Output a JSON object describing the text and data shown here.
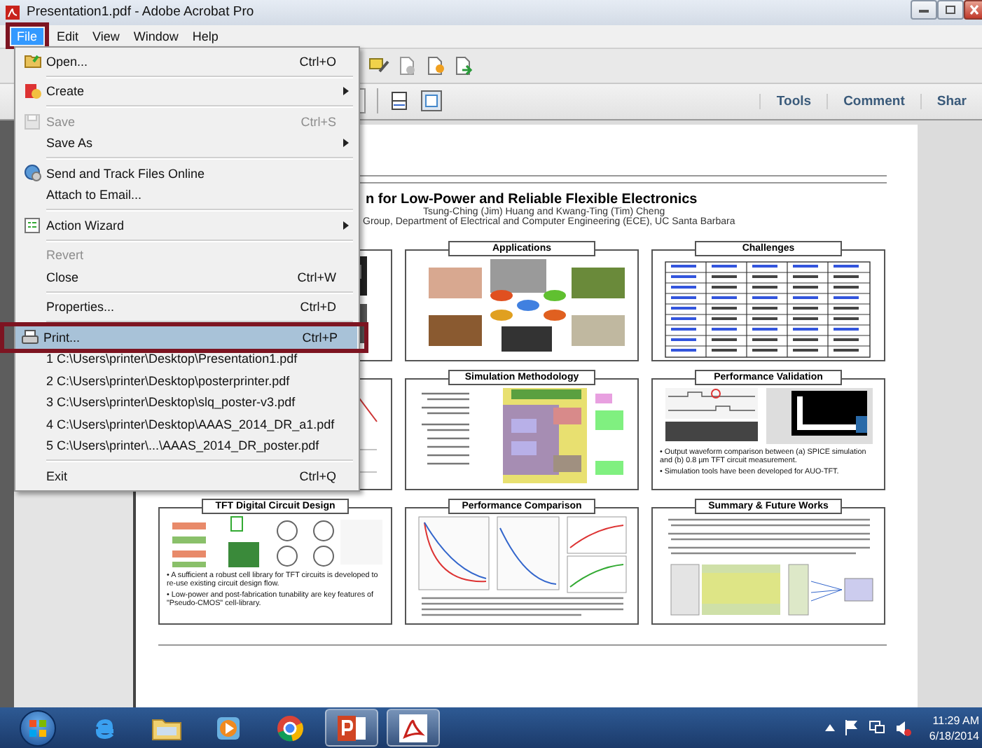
{
  "window": {
    "title": "Presentation1.pdf - Adobe Acrobat Pro"
  },
  "menu_bar": [
    {
      "label": "File",
      "selected": true
    },
    {
      "label": "Edit",
      "selected": false
    },
    {
      "label": "View",
      "selected": false
    },
    {
      "label": "Window",
      "selected": false
    },
    {
      "label": "Help",
      "selected": false
    }
  ],
  "file_menu": [
    {
      "kind": "item",
      "label": "Open...",
      "shortcut": "Ctrl+O",
      "submenu": false,
      "disabled": false,
      "selected": false
    },
    {
      "kind": "separator"
    },
    {
      "kind": "item",
      "label": "Create",
      "submenu": true,
      "disabled": false,
      "selected": false
    },
    {
      "kind": "separator"
    },
    {
      "kind": "item",
      "label": "Save",
      "shortcut": "Ctrl+S",
      "submenu": false,
      "disabled": true,
      "selected": false
    },
    {
      "kind": "item",
      "label": "Save As",
      "submenu": true,
      "disabled": false,
      "selected": false
    },
    {
      "kind": "separator"
    },
    {
      "kind": "item",
      "label": "Send and Track Files Online",
      "submenu": false,
      "disabled": false,
      "selected": false
    },
    {
      "kind": "item",
      "label": "Attach to Email...",
      "submenu": false,
      "disabled": false,
      "selected": false
    },
    {
      "kind": "separator"
    },
    {
      "kind": "item",
      "label": "Action Wizard",
      "submenu": true,
      "disabled": false,
      "selected": false
    },
    {
      "kind": "separator"
    },
    {
      "kind": "item",
      "label": "Revert",
      "submenu": false,
      "disabled": true,
      "selected": false
    },
    {
      "kind": "item",
      "label": "Close",
      "shortcut": "Ctrl+W",
      "submenu": false,
      "disabled": false,
      "selected": false
    },
    {
      "kind": "separator"
    },
    {
      "kind": "item",
      "label": "Properties...",
      "shortcut": "Ctrl+D",
      "submenu": false,
      "disabled": false,
      "selected": false
    },
    {
      "kind": "separator"
    },
    {
      "kind": "item",
      "label": "Print...",
      "shortcut": "Ctrl+P",
      "submenu": false,
      "disabled": false,
      "selected": true
    },
    {
      "kind": "item",
      "label": "1 C:\\Users\\printer\\Desktop\\Presentation1.pdf",
      "submenu": false,
      "disabled": false,
      "selected": false
    },
    {
      "kind": "item",
      "label": "2 C:\\Users\\printer\\Desktop\\posterprinter.pdf",
      "submenu": false,
      "disabled": false,
      "selected": false
    },
    {
      "kind": "item",
      "label": "3 C:\\Users\\printer\\Desktop\\slq_poster-v3.pdf",
      "submenu": false,
      "disabled": false,
      "selected": false
    },
    {
      "kind": "item",
      "label": "4 C:\\Users\\printer\\Desktop\\AAAS_2014_DR_a1.pdf",
      "submenu": false,
      "disabled": false,
      "selected": false
    },
    {
      "kind": "item",
      "label": "5 C:\\Users\\printer\\...\\AAAS_2014_DR_poster.pdf",
      "submenu": false,
      "disabled": false,
      "selected": false
    },
    {
      "kind": "separator"
    },
    {
      "kind": "item",
      "label": "Exit",
      "shortcut": "Ctrl+Q",
      "submenu": false,
      "disabled": false,
      "selected": false
    }
  ],
  "toolbar": {
    "panes": [
      "Tools",
      "Comment",
      "Shar"
    ]
  },
  "poster": {
    "title": "n for Low-Power and Reliable Flexible Electronics",
    "authors": "Tsung-Ching (Jim) Huang and Kwang-Ting (Tim) Cheng",
    "affiliation": "Group, Department of Electrical and Computer Engineering (ECE), UC Santa Barbara",
    "panels": [
      {
        "kind": "photos-left"
      },
      {
        "kind": "photos",
        "heading": "Applications"
      },
      {
        "kind": "table",
        "heading": "Challenges"
      },
      {
        "kind": "schematic"
      },
      {
        "kind": "diagram",
        "heading": "Simulation Methodology"
      },
      {
        "kind": "waveform",
        "heading": "Performance Validation",
        "bullets": [
          "• Output waveform comparison between (a) SPICE simulation and (b) 0.8 µm TFT circuit measurement.",
          "• Simulation tools have been developed for AUO-TFT."
        ]
      },
      {
        "kind": "circuits",
        "heading": "TFT Digital Circuit Design",
        "bullets": [
          "• A sufficient a robust cell library for TFT circuits is developed to re-use existing circuit design flow.",
          "• Low-power and post-fabrication tunability are key features of \"Pseudo-CMOS\" cell-library."
        ]
      },
      {
        "kind": "plots",
        "heading": "Performance Comparison"
      },
      {
        "kind": "summary",
        "heading": "Summary & Future Works"
      }
    ]
  },
  "taskbar": {
    "apps": [
      {
        "running": false
      },
      {
        "running": false
      },
      {
        "running": false
      },
      {
        "running": false
      },
      {
        "running": true
      },
      {
        "running": true
      }
    ],
    "time": "11:29 AM",
    "date": "6/18/2014"
  }
}
